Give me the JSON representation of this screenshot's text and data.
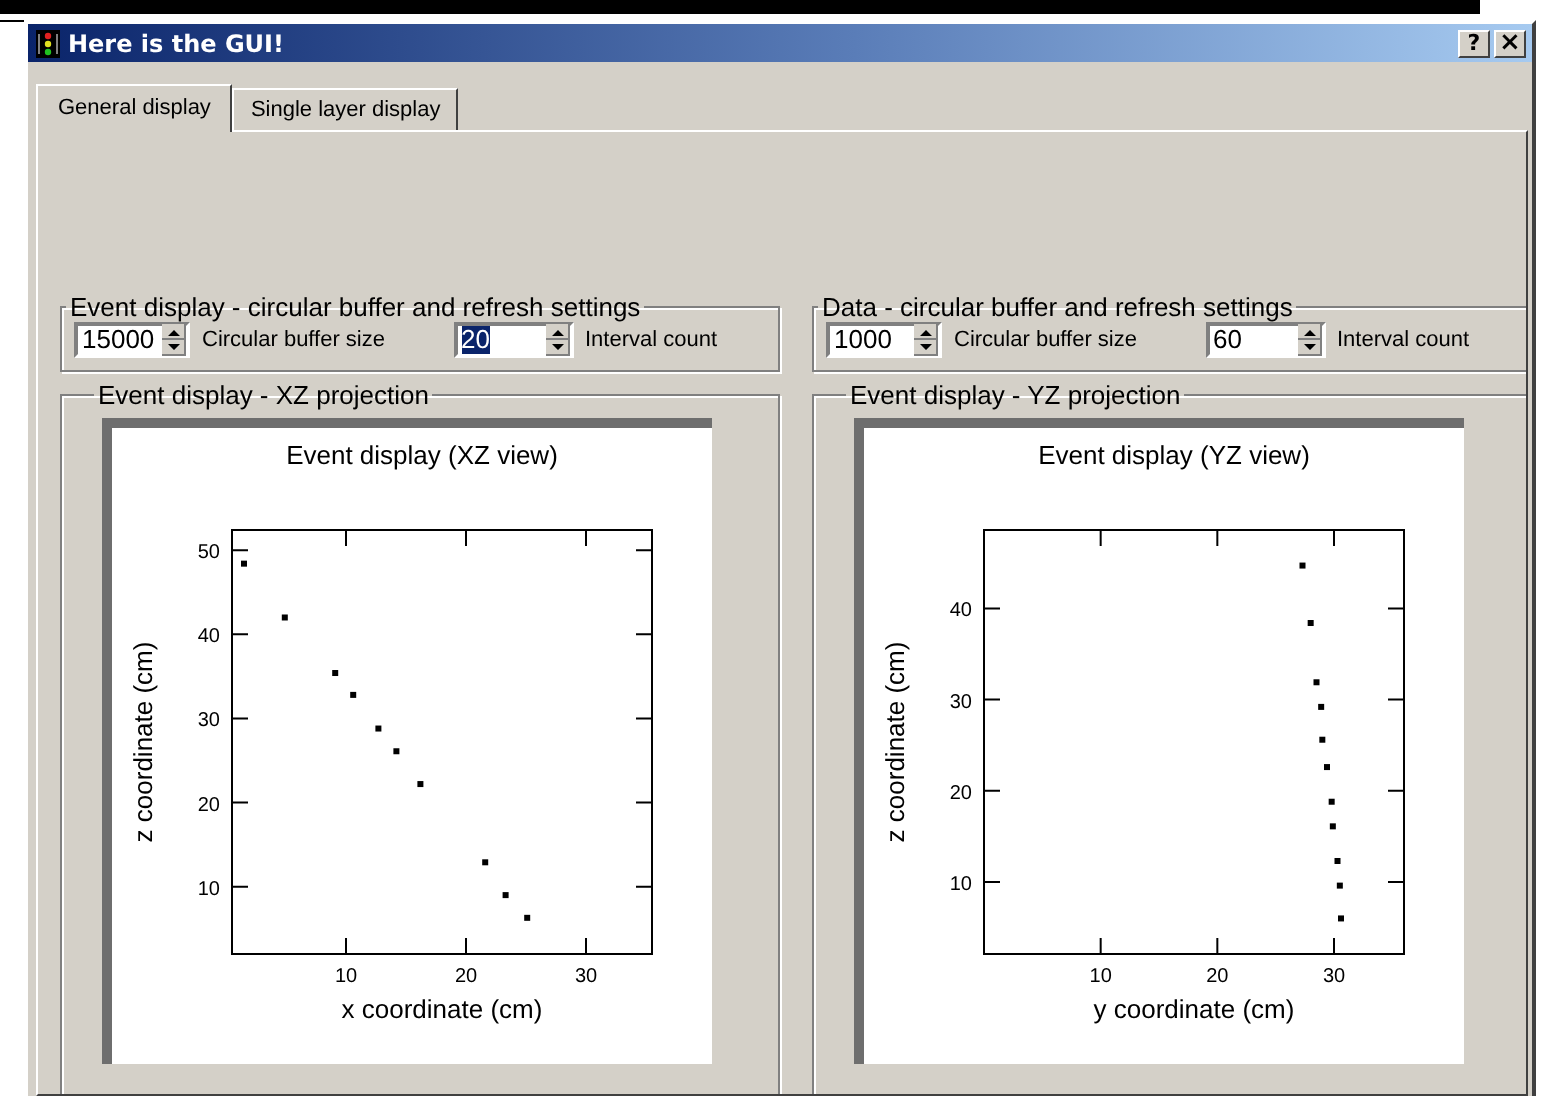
{
  "window": {
    "title": "Here is the GUI!",
    "buttons": [
      {
        "kind": "help",
        "label": "?"
      },
      {
        "kind": "close",
        "label": "×"
      }
    ]
  },
  "tabs": [
    {
      "label": "General display",
      "selected": true
    },
    {
      "label": "Single layer display",
      "selected": false
    }
  ],
  "settings_groups": [
    {
      "title": "Event display - circular buffer and refresh settings",
      "controls": [
        {
          "kind": "spinbox",
          "value": "15000",
          "highlighted": false
        },
        {
          "kind": "label",
          "text": "Circular buffer size"
        },
        {
          "kind": "spinbox",
          "value": "20",
          "highlighted": true
        },
        {
          "kind": "label",
          "text": "Interval count"
        }
      ]
    },
    {
      "title": "Data - circular buffer and refresh settings",
      "controls": [
        {
          "kind": "spinbox",
          "value": "1000",
          "highlighted": false
        },
        {
          "kind": "label",
          "text": "Circular buffer size"
        },
        {
          "kind": "spinbox",
          "value": "60",
          "highlighted": false
        },
        {
          "kind": "label",
          "text": "Interval count"
        }
      ]
    }
  ],
  "projections": [
    {
      "title": "Event display - XZ projection",
      "chart_data": {
        "type": "scatter",
        "title": "Event display (XZ view)",
        "xlabel": "x coordinate (cm)",
        "ylabel": "z coordinate (cm)",
        "xlim": [
          0.5,
          35.5
        ],
        "ylim": [
          2,
          52.4
        ],
        "xticks": [
          10,
          20,
          30
        ],
        "yticks": [
          10,
          20,
          30,
          40,
          50
        ],
        "x": [
          1.5,
          4.9,
          9.1,
          10.6,
          12.7,
          14.2,
          16.2,
          21.6,
          23.3,
          25.1
        ],
        "series": [
          {
            "color": "#000000",
            "values": [
              48.4,
              42,
              35.4,
              32.8,
              28.8,
              26.1,
              22.2,
              12.9,
              9.0,
              6.3
            ]
          }
        ]
      }
    },
    {
      "title": "Event display - YZ projection",
      "chart_data": {
        "type": "scatter",
        "title": "Event display (YZ view)",
        "xlabel": "y coordinate (cm)",
        "ylabel": "z coordinate (cm)",
        "xlim": [
          0,
          36
        ],
        "ylim": [
          2.1,
          48.6
        ],
        "xticks": [
          10,
          20,
          30
        ],
        "yticks": [
          10,
          20,
          30,
          40
        ],
        "x": [
          27.3,
          28.0,
          28.5,
          28.9,
          29.0,
          29.4,
          29.8,
          29.9,
          30.3,
          30.5,
          30.6
        ],
        "series": [
          {
            "color": "#000000",
            "values": [
              44.7,
              38.4,
              31.9,
              29.2,
              25.6,
              22.6,
              18.8,
              16.1,
              12.3,
              9.6,
              6.0
            ]
          }
        ]
      }
    }
  ]
}
